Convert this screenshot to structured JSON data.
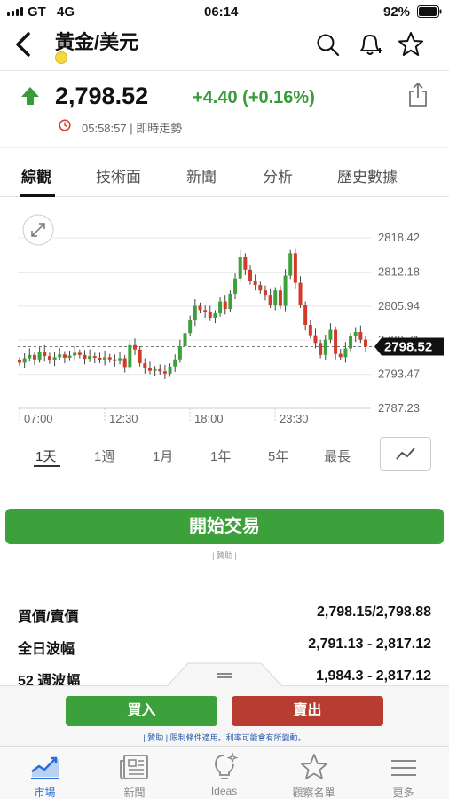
{
  "status_bar": {
    "carrier": "GT",
    "network": "4G",
    "time": "06:14",
    "battery": "92%"
  },
  "header": {
    "title": "黃金/美元"
  },
  "quote": {
    "price": "2,798.52",
    "change": "+4.40 (+0.16%)",
    "direction": "up",
    "time_text": "05:58:57 | 即時走勢",
    "up_color": "#3a9b3a"
  },
  "tabs": [
    "綜觀",
    "技術面",
    "新聞",
    "分析",
    "歷史數據"
  ],
  "chart": {
    "y_ticks": [
      "2818.42",
      "2812.18",
      "2805.94",
      "2799.71",
      "2793.47",
      "2787.23"
    ],
    "x_ticks": [
      "07:00",
      "12:30",
      "18:00",
      "23:30"
    ],
    "current_price": "2798.52",
    "candle_up_color": "#3ca13b",
    "candle_down_color": "#d23a2a"
  },
  "ranges": [
    "1天",
    "1週",
    "1月",
    "1年",
    "5年",
    "最長"
  ],
  "start_trading": {
    "label": "開始交易",
    "sponsor": "| 贊助 |"
  },
  "stats": [
    {
      "label": "買價/賣價",
      "value": "2,798.15/2,798.88"
    },
    {
      "label": "全日波幅",
      "value": "2,791.13 - 2,817.12"
    },
    {
      "label": "52 週波幅",
      "value": "1,984.3 - 2,817.12"
    }
  ],
  "trade": {
    "buy_label": "買入",
    "sell_label": "賣出",
    "disclaimer": "| 贊助 | 限制條件適用。利率可能會有所變動。"
  },
  "tabbar": [
    {
      "label": "市場",
      "icon": "market-chart-icon",
      "active": true
    },
    {
      "label": "新聞",
      "icon": "newspaper-icon",
      "active": false
    },
    {
      "label": "Ideas",
      "icon": "lightbulb-icon",
      "active": false
    },
    {
      "label": "觀察名單",
      "icon": "star-icon",
      "active": false
    },
    {
      "label": "更多",
      "icon": "menu-icon",
      "active": false
    }
  ]
}
